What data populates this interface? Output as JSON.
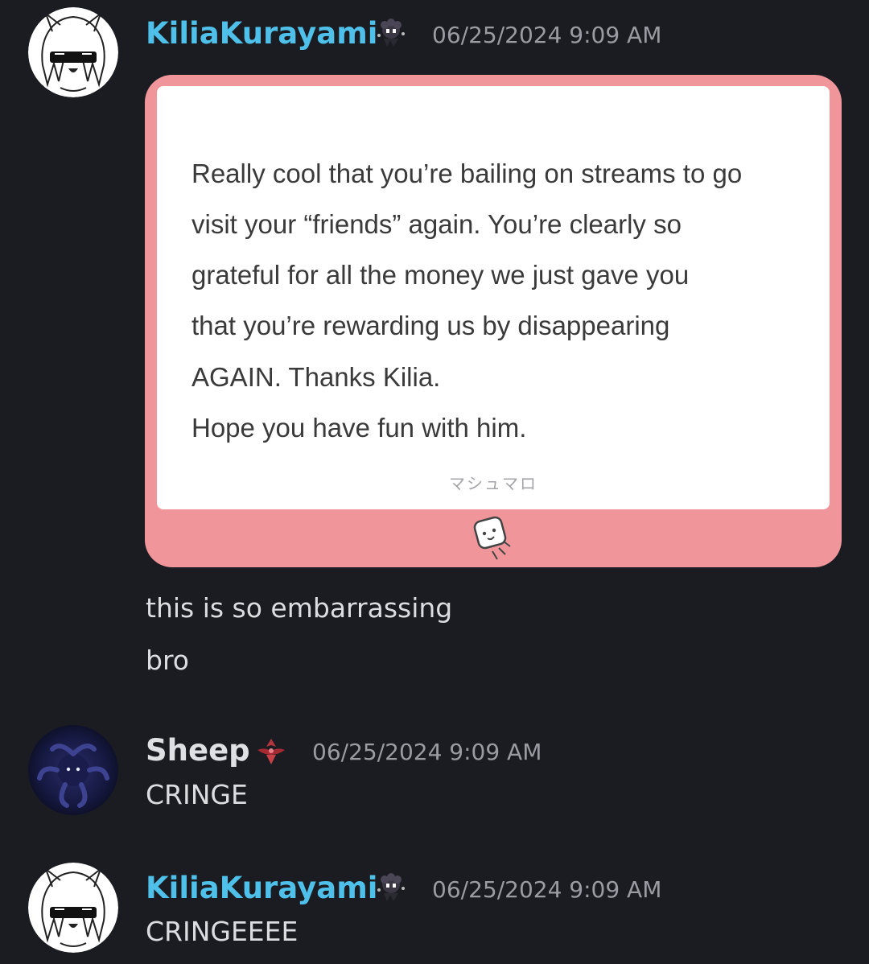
{
  "messages": [
    {
      "username": "KiliaKurayami",
      "role_icon": "dark-creature-role-icon",
      "timestamp": "06/25/2024 9:09 AM",
      "embed": {
        "lines": [
          "Really cool that you’re bailing on streams to go",
          "visit your “friends” again. You’re clearly so",
          "grateful for all the money we just gave you",
          "that you’re rewarding us by disappearing",
          "AGAIN. Thanks Kilia.",
          "Hope you have fun with him."
        ],
        "footer": "マシュマロ",
        "footer_icon": "marshmallow-icon"
      },
      "text_lines": [
        "this is so embarrassing",
        "bro"
      ]
    },
    {
      "username": "Sheep",
      "role_icon": "red-crest-role-icon",
      "timestamp": "06/25/2024 9:09 AM",
      "text_lines": [
        "CRINGE"
      ]
    },
    {
      "username": "KiliaKurayami",
      "role_icon": "dark-creature-role-icon",
      "timestamp": "06/25/2024 9:09 AM",
      "text_lines": [
        "CRINGEEEE"
      ]
    }
  ],
  "colors": {
    "background": "#1b1c21",
    "username_blue": "#4ec0e9",
    "username_white": "#dfe0e4",
    "timestamp": "#9b9ca3",
    "embed_pink": "#f0969b"
  }
}
